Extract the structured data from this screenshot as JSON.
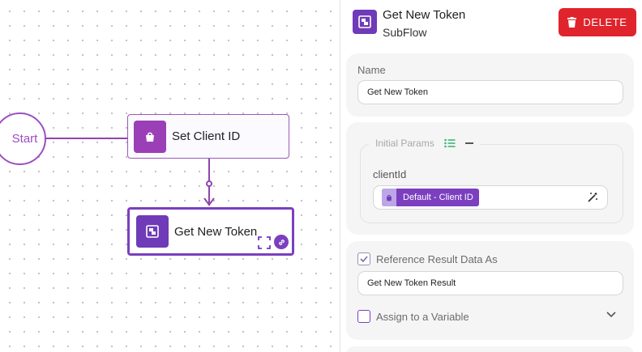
{
  "canvas": {
    "start_label": "Start",
    "nodes": [
      {
        "label": "Set Client ID",
        "icon": "bag-icon"
      },
      {
        "label": "Get New Token",
        "icon": "subflow-icon"
      }
    ]
  },
  "panel": {
    "title": "Get New Token",
    "subtitle": "SubFlow",
    "delete_label": "DELETE",
    "name": {
      "label": "Name",
      "value": "Get New Token"
    },
    "params": {
      "legend": "Initial Params",
      "param_name": "clientId",
      "chip_label": "Default - Client ID"
    },
    "ref": {
      "checkbox_label": "Reference Result Data As",
      "value": "Get New Token Result",
      "assign_label": "Assign to a Variable"
    }
  },
  "colors": {
    "accent": "#7b3fbf",
    "danger": "#e0242c",
    "start": "#9b4fc2"
  }
}
